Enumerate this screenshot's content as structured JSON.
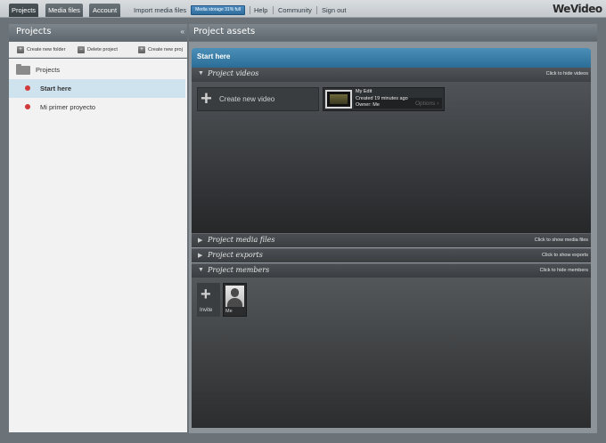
{
  "nav": {
    "tabs": [
      "Projects",
      "Media files",
      "Account"
    ],
    "import_label": "Import media files",
    "storage_label": "Media storage 31% full",
    "storage_percent": 31,
    "links": [
      "Help",
      "Community",
      "Sign out"
    ],
    "logo": "WeVideo"
  },
  "left_panel": {
    "title": "Projects",
    "collapse_icon": "double-chevron-left",
    "toolbar": [
      "Create new folder",
      "Delete project",
      "Create new proj"
    ],
    "tree_root": "Projects",
    "projects": [
      {
        "label": "Start here",
        "selected": true
      },
      {
        "label": "Mi primer proyecto",
        "selected": false
      }
    ]
  },
  "right_panel": {
    "title": "Project assets",
    "project_title": "Start here",
    "sections": {
      "videos": {
        "title": "Project videos",
        "action": "Click to hide videos"
      },
      "media": {
        "title": "Project media files",
        "action": "Click to show media files"
      },
      "exports": {
        "title": "Project exports",
        "action": "Click to show exports"
      },
      "members": {
        "title": "Project members",
        "action": "Click to hide members"
      }
    },
    "create_video_label": "Create new video",
    "video": {
      "title": "My Edit",
      "created": "Created 19 minutes ago",
      "owner": "Owner: Me",
      "options_label": "Options"
    },
    "invite_label": "Invite",
    "member_label": "Me"
  },
  "colors": {
    "accent": "#2b6d96",
    "project_dot": "#d23a3a",
    "selected_row": "#cfe3ef"
  }
}
